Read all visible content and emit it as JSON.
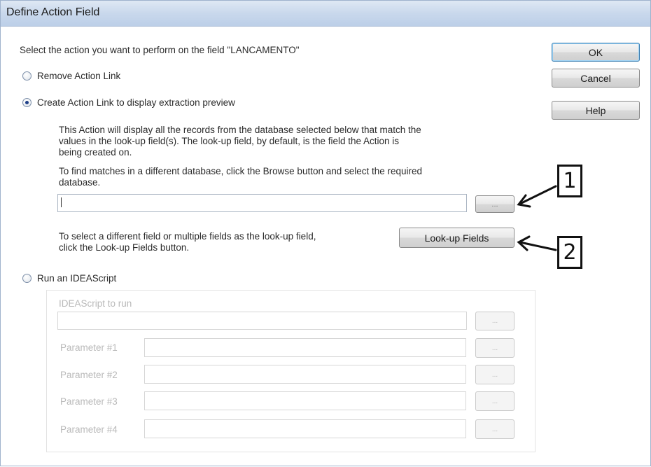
{
  "window": {
    "title": "Define Action Field"
  },
  "instruction": "Select the action you want to perform on the field \"LANCAMENTO\"",
  "buttons": {
    "ok": "OK",
    "cancel": "Cancel",
    "help": "Help"
  },
  "options": {
    "remove": {
      "label": "Remove Action Link",
      "checked": false
    },
    "create": {
      "label": "Create Action Link to display extraction preview",
      "checked": true,
      "description_lines": [
        "This Action will display all the records from the database selected below that match the",
        "values in the look-up field(s).  The look-up field, by default, is the field the Action is",
        "being created on."
      ],
      "browse_hint_lines": [
        "To find matches in a different database, click the Browse button and select the required",
        "database."
      ],
      "database_value": "",
      "browse_label": "...",
      "lookup_hint_lines": [
        "To select a different field or multiple fields as the look-up field,",
        "click the Look-up Fields button."
      ],
      "lookup_button": "Look-up Fields"
    },
    "script": {
      "label": "Run an IDEAScript",
      "checked": false,
      "script_label": "IDEAScript to run",
      "browse_label": "...",
      "params": [
        {
          "label": "Parameter #1",
          "value": ""
        },
        {
          "label": "Parameter #2",
          "value": ""
        },
        {
          "label": "Parameter #3",
          "value": ""
        },
        {
          "label": "Parameter #4",
          "value": ""
        }
      ]
    }
  },
  "callouts": [
    "1",
    "2"
  ]
}
